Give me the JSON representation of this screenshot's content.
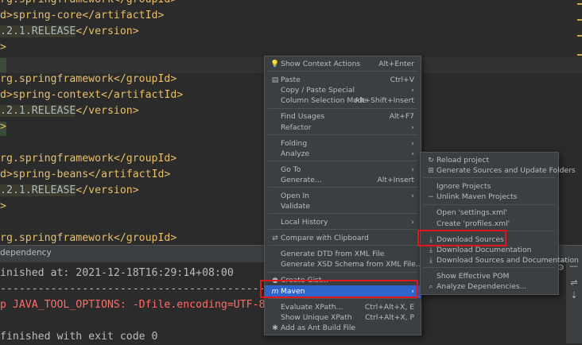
{
  "editor": {
    "lines": [
      {
        "pre": "rg.springframework</",
        "tag": "groupId",
        "post": ">"
      },
      {
        "pre": "d>spring-core</",
        "tag": "artifactId",
        "post": ">"
      },
      {
        "pre": ".2.1.RELEASE",
        "close": "</version>"
      },
      {
        "pre": ">"
      },
      {
        "pre": ""
      },
      {
        "pre": "rg.springframework</",
        "tag": "groupId",
        "post": ">"
      },
      {
        "pre": "d>spring-context</",
        "tag": "artifactId",
        "post": ">"
      },
      {
        "pre": ".2.1.RELEASE",
        "close": "</version>"
      },
      {
        "pre": ">"
      },
      {
        "pre": ""
      },
      {
        "pre": "rg.springframework</",
        "tag": "groupId",
        "post": ">"
      },
      {
        "pre": "d>spring-beans</",
        "tag": "artifactId",
        "post": ">"
      },
      {
        "pre": ".2.1.RELEASE",
        "close": "</version>"
      },
      {
        "pre": ">"
      },
      {
        "pre": ""
      },
      {
        "pre": "rg.springframework</",
        "tag": "groupId",
        "post": ">"
      }
    ]
  },
  "tool_window": {
    "title": "dependency",
    "console": [
      {
        "text": "inished at: 2021-12-18T16:29:14+08:00",
        "style": "normal"
      },
      {
        "text": "-----------------------------------------------------------------------",
        "style": "normal"
      },
      {
        "text": "p JAVA_TOOL_OPTIONS: -Dfile.encoding=UTF-8",
        "style": "red"
      },
      {
        "text": "",
        "style": "normal"
      },
      {
        "text": "finished with exit code 0",
        "style": "normal"
      }
    ]
  },
  "context_menu": {
    "items": [
      {
        "label": "Show Context Actions",
        "shortcut": "Alt+Enter",
        "icon": "bulb-icon"
      },
      {
        "sep": true
      },
      {
        "label": "Paste",
        "shortcut": "Ctrl+V",
        "icon": "clipboard-icon"
      },
      {
        "label": "Copy / Paste Special",
        "submenu": true
      },
      {
        "label": "Column Selection Mode",
        "shortcut": "Alt+Shift+Insert"
      },
      {
        "sep": true
      },
      {
        "label": "Find Usages",
        "shortcut": "Alt+F7"
      },
      {
        "label": "Refactor",
        "submenu": true
      },
      {
        "sep": true
      },
      {
        "label": "Folding",
        "submenu": true
      },
      {
        "label": "Analyze",
        "submenu": true
      },
      {
        "sep": true
      },
      {
        "label": "Go To",
        "submenu": true
      },
      {
        "label": "Generate...",
        "shortcut": "Alt+Insert"
      },
      {
        "sep": true
      },
      {
        "label": "Open In",
        "submenu": true
      },
      {
        "label": "Validate"
      },
      {
        "sep": true
      },
      {
        "label": "Local History",
        "submenu": true
      },
      {
        "sep": true
      },
      {
        "label": "Compare with Clipboard",
        "icon": "compare-icon"
      },
      {
        "sep": true
      },
      {
        "label": "Generate DTD from XML File"
      },
      {
        "label": "Generate XSD Schema from XML File..."
      },
      {
        "sep": true
      },
      {
        "label": "Create Gist...",
        "icon": "github-icon"
      },
      {
        "label": "Maven",
        "submenu": true,
        "icon": "maven-icon",
        "selected": true
      },
      {
        "sep": true
      },
      {
        "label": "Evaluate XPath...",
        "shortcut": "Ctrl+Alt+X, E"
      },
      {
        "label": "Show Unique XPath",
        "shortcut": "Ctrl+Alt+X, P"
      },
      {
        "label": "Add as Ant Build File",
        "icon": "ant-icon"
      }
    ]
  },
  "maven_submenu": {
    "items": [
      {
        "label": "Reload project",
        "icon": "reload-icon"
      },
      {
        "label": "Generate Sources and Update Folders",
        "icon": "generate-sources-icon"
      },
      {
        "sep": true
      },
      {
        "label": "Ignore Projects"
      },
      {
        "label": "Unlink Maven Projects",
        "icon": "minus-icon"
      },
      {
        "sep": true
      },
      {
        "label": "Open 'settings.xml'"
      },
      {
        "label": "Create 'profiles.xml'"
      },
      {
        "sep": true
      },
      {
        "label": "Download Sources",
        "icon": "download-icon"
      },
      {
        "label": "Download Documentation",
        "icon": "download-icon"
      },
      {
        "label": "Download Sources and Documentation",
        "icon": "download-icon"
      },
      {
        "sep": true
      },
      {
        "label": "Show Effective POM"
      },
      {
        "label": "Analyze Dependencies...",
        "icon": "search-icon"
      }
    ]
  },
  "colors": {
    "menu_bg": "#3c3f41",
    "selection": "#2f65ca",
    "highlight_box": "#e0161d",
    "xml_tag": "#e8bf6a",
    "console_error": "#ff6b68"
  }
}
